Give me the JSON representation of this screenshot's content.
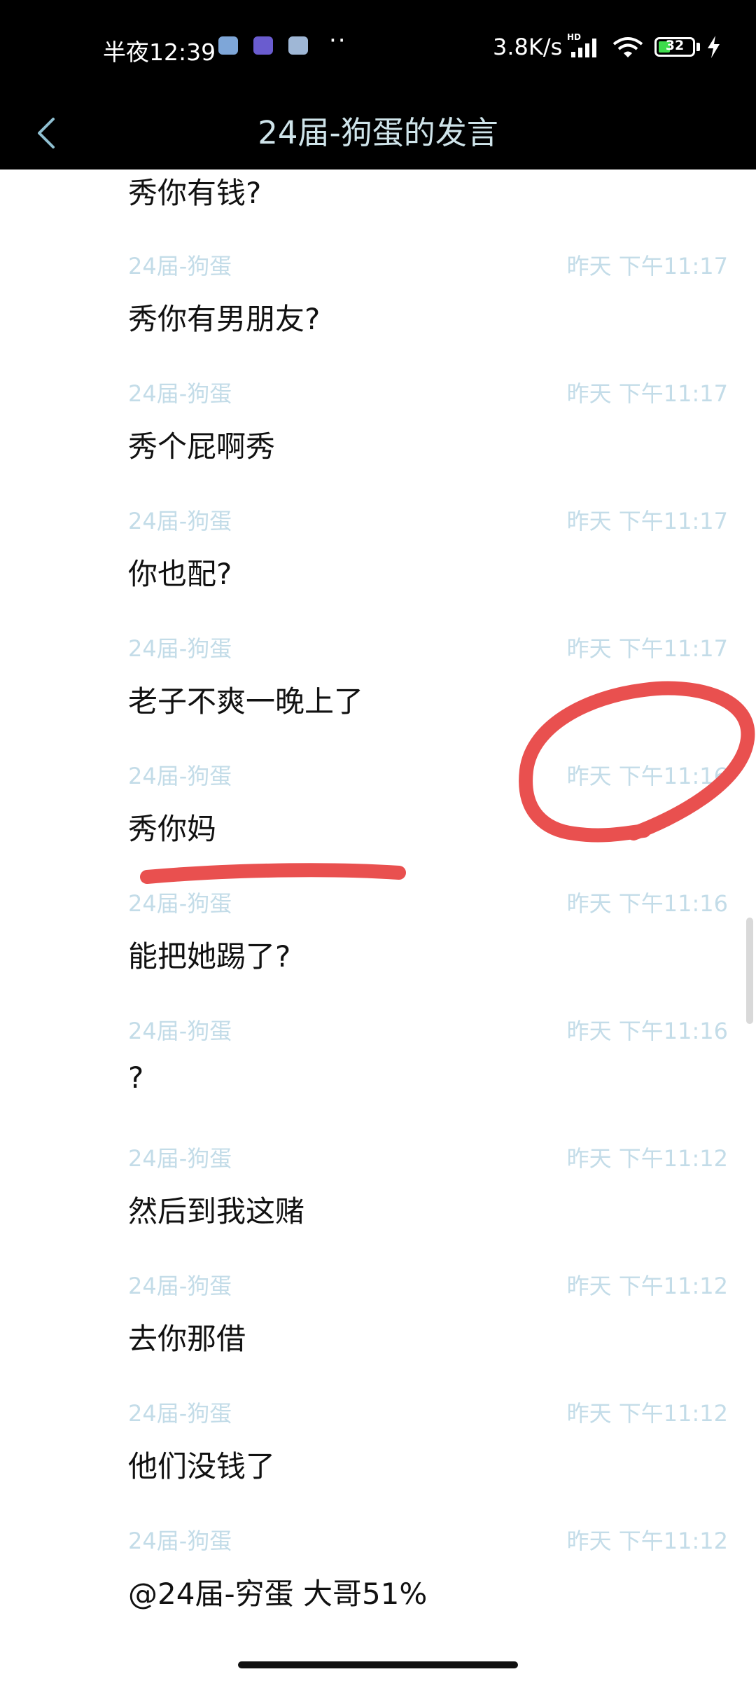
{
  "status_bar": {
    "time": "半夜12:39",
    "notification_icons": [
      "photo-app-icon",
      "emoji-app-icon",
      "message-app-icon"
    ],
    "more": "··",
    "net_speed": "3.8K/s",
    "hd_badge": "HD",
    "battery_level": "32",
    "charging": true,
    "signal_icon": "signal-icon",
    "wifi_icon": "wifi-icon"
  },
  "header": {
    "back_icon": "chevron-left-icon",
    "title": "24届-狗蛋的发言"
  },
  "messages": [
    {
      "author": "",
      "time": "",
      "text": "秀你有钱?"
    },
    {
      "author": "24届-狗蛋",
      "time": "昨天 下午11:17",
      "text": "秀你有男朋友?"
    },
    {
      "author": "24届-狗蛋",
      "time": "昨天 下午11:17",
      "text": "秀个屁啊秀"
    },
    {
      "author": "24届-狗蛋",
      "time": "昨天 下午11:17",
      "text": "你也配?"
    },
    {
      "author": "24届-狗蛋",
      "time": "昨天 下午11:17",
      "text": "老子不爽一晚上了"
    },
    {
      "author": "24届-狗蛋",
      "time": "昨天 下午11:16",
      "text": "秀你妈"
    },
    {
      "author": "24届-狗蛋",
      "time": "昨天 下午11:16",
      "text": "能把她踢了?"
    },
    {
      "author": "24届-狗蛋",
      "time": "昨天 下午11:16",
      "text": "?"
    },
    {
      "author": "24届-狗蛋",
      "time": "昨天 下午11:12",
      "text": "然后到我这赌"
    },
    {
      "author": "24届-狗蛋",
      "time": "昨天 下午11:12",
      "text": "去你那借"
    },
    {
      "author": "24届-狗蛋",
      "time": "昨天 下午11:12",
      "text": "他们没钱了"
    },
    {
      "author": "24届-狗蛋",
      "time": "昨天 下午11:12",
      "text": "@24届-穷蛋 大哥51%"
    }
  ],
  "annotation_color": "#e9504f"
}
